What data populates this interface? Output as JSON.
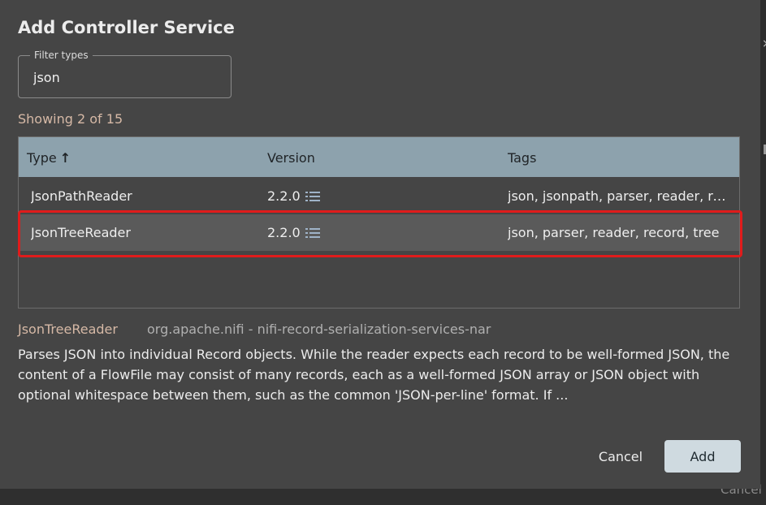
{
  "dialog": {
    "title": "Add Controller Service",
    "filter": {
      "label": "Filter types",
      "value": "json"
    },
    "showing": "Showing 2 of 15",
    "table": {
      "columns": [
        "Type",
        "Version",
        "Tags"
      ],
      "sort_indicator": "↑",
      "rows": [
        {
          "type": "JsonPathReader",
          "version": "2.2.0",
          "tags": "json, jsonpath, parser, reader, record",
          "selected": false
        },
        {
          "type": "JsonTreeReader",
          "version": "2.2.0",
          "tags": "json, parser, reader, record, tree",
          "selected": true
        }
      ]
    },
    "selected_detail": {
      "name": "JsonTreeReader",
      "bundle": "org.apache.nifi - nifi-record-serialization-services-nar",
      "description": "Parses JSON into individual Record objects. While the reader expects each record to be well-formed JSON, the content of a FlowFile may consist of many records, each as a well-formed JSON array or JSON object with optional whitespace between them, such as the common 'JSON-per-line' format. If ..."
    },
    "buttons": {
      "cancel": "Cancel",
      "add": "Add"
    }
  },
  "backdrop": {
    "cancel_label": "Cancel",
    "close_glyph": "×"
  },
  "colors": {
    "dialog_bg": "#454545",
    "header_bg": "#8da2ad",
    "selected_row_bg": "#5a5a5a",
    "highlight_border": "#e01b1b",
    "primary_button_bg": "#cfdae0",
    "accent_text": "#d6b9a6"
  },
  "icons": {
    "version_info": "list-icon",
    "sort": "sort-ascending-icon"
  }
}
